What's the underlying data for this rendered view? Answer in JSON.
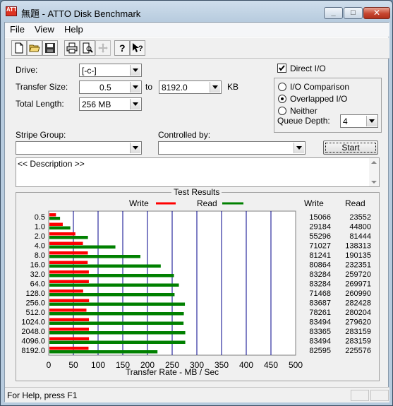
{
  "window": {
    "title": "無題 - ATTO Disk Benchmark",
    "icon_text": "ATTO",
    "title_color": "#000000"
  },
  "menu": {
    "items": [
      "File",
      "View",
      "Help"
    ]
  },
  "toolbar": {
    "buttons": [
      "new-file-icon",
      "open-folder-icon",
      "save-icon",
      "print-icon",
      "print-preview-icon",
      "move-icon",
      "help-icon",
      "context-help-icon"
    ]
  },
  "form": {
    "drive_label": "Drive:",
    "drive_value": "[-c-]",
    "transfer_size_label": "Transfer Size:",
    "transfer_from": "0.5",
    "to_label": "to",
    "transfer_to": "8192.0",
    "kb_label": "KB",
    "total_length_label": "Total Length:",
    "total_length_value": "256 MB",
    "direct_io_label": "Direct I/O",
    "direct_io_checked": true,
    "io_comparison_label": "I/O Comparison",
    "overlapped_io_label": "Overlapped I/O",
    "neither_label": "Neither",
    "selected_mode": "Overlapped I/O",
    "queue_depth_label": "Queue Depth:",
    "queue_depth_value": "4",
    "stripe_group_label": "Stripe Group:",
    "stripe_group_value": "",
    "controlled_by_label": "Controlled by:",
    "controlled_by_value": "",
    "start_label": "Start",
    "description_text": "<< Description >>"
  },
  "results": {
    "group_title": "Test Results",
    "legend_write": "Write",
    "legend_read": "Read",
    "col_write": "Write",
    "col_read": "Read",
    "write_color": "#ff0000",
    "read_color": "#008000",
    "grid_color": "#00008b"
  },
  "chart_data": {
    "type": "bar",
    "orientation": "horizontal",
    "categories": [
      "0.5",
      "1.0",
      "2.0",
      "4.0",
      "8.0",
      "16.0",
      "32.0",
      "64.0",
      "128.0",
      "256.0",
      "512.0",
      "1024.0",
      "2048.0",
      "4096.0",
      "8192.0"
    ],
    "series": [
      {
        "name": "Write",
        "values": [
          15066,
          29184,
          55296,
          71027,
          81241,
          80864,
          83284,
          83284,
          71468,
          83687,
          78261,
          83494,
          83365,
          83494,
          82595
        ]
      },
      {
        "name": "Read",
        "values": [
          23552,
          44800,
          81444,
          138313,
          190135,
          232351,
          259720,
          269971,
          260990,
          282428,
          280204,
          279620,
          283159,
          283159,
          225576
        ]
      }
    ],
    "xlabel": "Transfer Rate - MB / Sec",
    "x_ticks": [
      0,
      50,
      100,
      150,
      200,
      250,
      300,
      350,
      400,
      450,
      500
    ],
    "xlim": [
      0,
      500
    ],
    "value_unit": "KB/s",
    "legend": "top"
  },
  "status": {
    "text": "For Help, press F1"
  }
}
